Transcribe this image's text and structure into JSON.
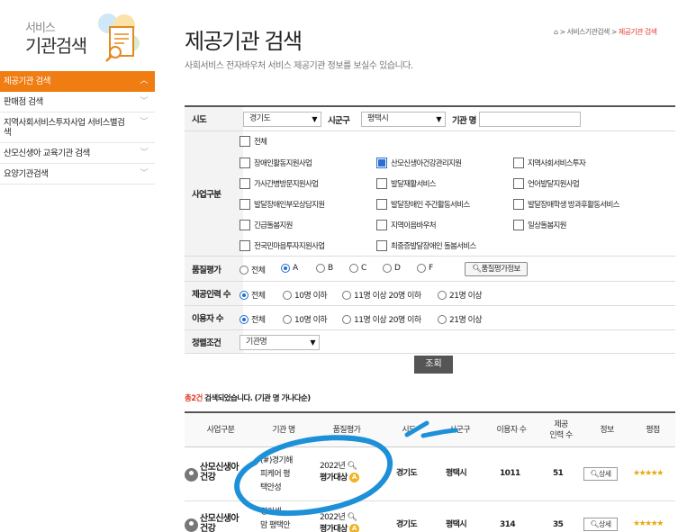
{
  "sidebar": {
    "title_small": "서비스",
    "title_large": "기관검색",
    "items": [
      {
        "label": "제공기관 검색",
        "active": true
      },
      {
        "label": "판매점 검색"
      },
      {
        "label": "지역사회서비스투자사업 서비스별검색"
      },
      {
        "label": "산모신생아 교육기관 검색"
      },
      {
        "label": "요양기관검색"
      }
    ]
  },
  "header": {
    "title": "제공기관 검색",
    "subtitle": "사회서비스 전자바우처 서비스 제공기관 정보를 보실수 있습니다.",
    "breadcrumb": {
      "home_icon": "home-icon",
      "level1": "서비스기관검색",
      "current": "제공기관 검색",
      "separator": ">"
    }
  },
  "form": {
    "sido_label": "시도",
    "sido_value": "경기도",
    "sigungu_label": "시군구",
    "sigungu_value": "평택시",
    "org_name_label": "기관 명",
    "business_label": "사업구분",
    "business_all": "전체",
    "business_types": [
      {
        "label": "장애인활동지원사업",
        "checked": false
      },
      {
        "label": "산모신생아건강관리지원",
        "checked": true
      },
      {
        "label": "지역사회서비스투자",
        "checked": false
      },
      {
        "label": "가사간병방문지원사업",
        "checked": false
      },
      {
        "label": "발달재활서비스",
        "checked": false
      },
      {
        "label": "언어발달지원사업",
        "checked": false
      },
      {
        "label": "발달장애인부모상담지원",
        "checked": false
      },
      {
        "label": "발달장애인 주간활동서비스",
        "checked": false
      },
      {
        "label": "발달장애학생 방과후활동서비스",
        "checked": false
      },
      {
        "label": "긴급돌봄지원",
        "checked": false
      },
      {
        "label": "지역이음바우처",
        "checked": false
      },
      {
        "label": "일상돌봄지원",
        "checked": false
      },
      {
        "label": "전국민마음투자지원사업",
        "checked": false
      },
      {
        "label": "최중증발달장애인 돌봄서비스",
        "checked": false
      }
    ],
    "quality_label": "품질평가",
    "quality_options": [
      "전체",
      "A",
      "B",
      "C",
      "D",
      "F"
    ],
    "quality_selected": "A",
    "quality_button": "품질평가정보",
    "staff_label": "제공인력 수",
    "staff_options": [
      "전체",
      "10명 이하",
      "11명 이상 20명 이하",
      "21명 이상"
    ],
    "staff_selected": "전체",
    "users_label": "이용자 수",
    "users_options": [
      "전체",
      "10명 이하",
      "11명 이상 20명 이하",
      "21명 이상"
    ],
    "users_selected": "전체",
    "sort_label": "정렬조건",
    "sort_value": "기관명",
    "search_button": "조회"
  },
  "result": {
    "count": "총2건",
    "text": " 검색되었습니다. (기관 명 가나다순)"
  },
  "table": {
    "headers": [
      "사업구분",
      "기관 명",
      "품질평가",
      "시도",
      "시군구",
      "이용자 수",
      "제공\n인력 수",
      "정보",
      "평점"
    ],
    "rows": [
      {
        "business": "산모신생아\n건강",
        "org": "(#)경기해\n피케어 평\n택안성",
        "quality": "2022년",
        "quality_sub": "평가대상",
        "grade": "A",
        "sido": "경기도",
        "sigungu": "평택시",
        "users": "1011",
        "staff": "51",
        "info": "상세",
        "rating": "★★★★★"
      },
      {
        "business": "산모신생아\n건강",
        "org": "경기센\n맘 평택안",
        "quality": "2022년",
        "quality_sub": "평가대상",
        "grade": "A",
        "sido": "경기도",
        "sigungu": "평택시",
        "users": "314",
        "staff": "35",
        "info": "상세",
        "rating": "★★★★★"
      }
    ]
  },
  "colors": {
    "accent": "#f07d12",
    "annotation": "#1e90d8",
    "check": "#2c6fce",
    "alert": "#e23a2b"
  }
}
